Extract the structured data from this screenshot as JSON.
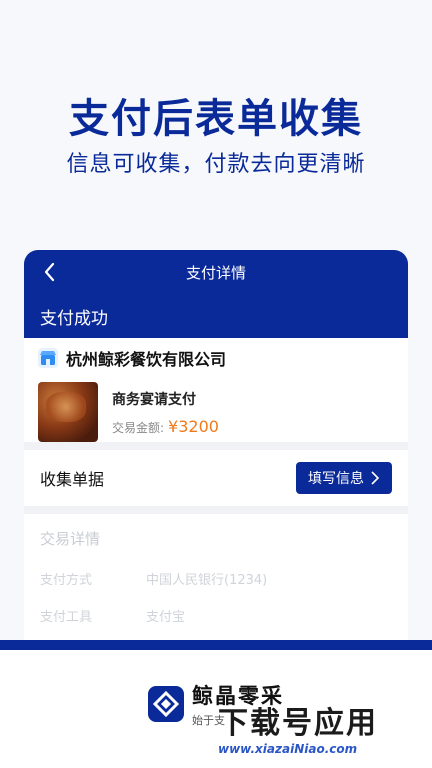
{
  "hero": {
    "title": "支付后表单收集",
    "subtitle": "信息可收集，付款去向更清晰"
  },
  "nav": {
    "title": "支付详情",
    "back_icon": "chevron-left-icon"
  },
  "status": {
    "text": "支付成功"
  },
  "merchant": {
    "name": "杭州鲸彩餐饮有限公司",
    "icon": "shop-icon"
  },
  "product": {
    "name": "商务宴请支付",
    "amount_label": "交易金额:",
    "amount_value": "¥3200"
  },
  "collect": {
    "title": "收集单据",
    "button_label": "填写信息"
  },
  "details": {
    "title": "交易详情",
    "rows": [
      {
        "key": "支付方式",
        "value": "中国人民银行(1234)"
      },
      {
        "key": "支付工具",
        "value": "支付宝"
      }
    ]
  },
  "brand": {
    "name": "鲸晶零采",
    "slogan": "始于支"
  },
  "watermark": {
    "main": "下载号应用",
    "url": "www.xiazaiNiao.com"
  },
  "colors": {
    "primary": "#0b2a99",
    "accent_amount": "#f07a1a"
  }
}
